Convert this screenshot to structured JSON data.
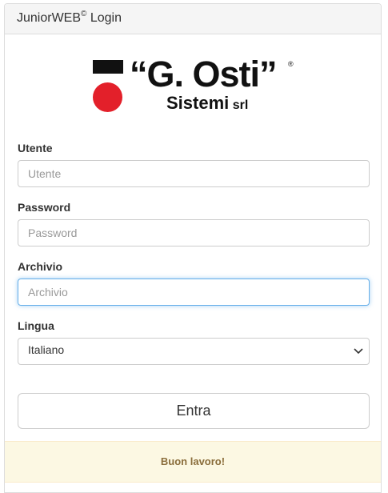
{
  "header": {
    "title": "JuniorWEB",
    "title_sup": "©",
    "title_suffix": " Login"
  },
  "logo": {
    "brand": "“G. Osti”",
    "reg": "®",
    "sub": "Sistemi",
    "sub_small": " srl",
    "colors": {
      "square": "#111111",
      "dot": "#e3202a"
    }
  },
  "form": {
    "user_label": "Utente",
    "user_placeholder": "Utente",
    "password_label": "Password",
    "password_placeholder": "Password",
    "archive_label": "Archivio",
    "archive_placeholder": "Archivio",
    "language_label": "Lingua",
    "language_value": "Italiano",
    "submit_label": "Entra"
  },
  "footer": {
    "message": "Buon lavoro!"
  },
  "colors": {
    "focus": "#66afe9",
    "warning_bg": "#fcf8e3",
    "warning_text": "#8a6d3b"
  }
}
